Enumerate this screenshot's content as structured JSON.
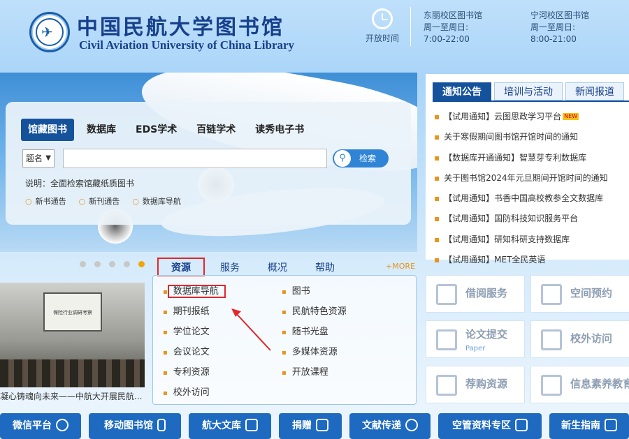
{
  "header": {
    "logo_cn": "中国民航大学图书馆",
    "logo_en": "Civil Aviation University of China Library",
    "open_time_label": "开放时间",
    "campuses": [
      {
        "name": "东丽校区图书馆",
        "days": "周一至周日:",
        "hours": "7:00-22:00"
      },
      {
        "name": "宁河校区图书馆",
        "days": "周一至周日:",
        "hours": "8:00-21:00"
      }
    ]
  },
  "search": {
    "tabs": [
      "馆藏图书",
      "数据库",
      "EDS学术",
      "百链学术",
      "读秀电子书"
    ],
    "field_select": "题名",
    "input_value": "",
    "button": "检索",
    "note": "说明：全面检索馆藏纸质图书",
    "links": [
      "新书通告",
      "新刊通告",
      "数据库导航"
    ]
  },
  "carousel": {
    "dots": 5,
    "active": 5
  },
  "notice": {
    "tabs": [
      "通知公告",
      "培训与活动",
      "新闻报道"
    ],
    "items": [
      "【试用通知】云图思政学习平台",
      "关于寒假期间图书馆开馆时间的通知",
      "【数据库开通通知】智慧芽专利数据库",
      "关于图书馆2024年元旦期间开馆时间的通知",
      "【试用通知】书香中国高校教参全文数据库",
      "【试用通知】国防科技知识服务平台",
      "【试用通知】研知科研支持数据库",
      "【试用通知】MET全民英语"
    ],
    "new_badge": "NEW"
  },
  "photo": {
    "screen_text": "保险行业调研考察",
    "caption": "凝心铸魂向未来——中航大开展民航..."
  },
  "resources": {
    "tabs": [
      "资源",
      "服务",
      "概况",
      "帮助"
    ],
    "more": "+MORE",
    "left": [
      "数据库导航",
      "期刊报纸",
      "学位论文",
      "会议论文",
      "专利资源",
      "校外访问"
    ],
    "right": [
      "图书",
      "民航特色资源",
      "随书光盘",
      "多媒体资源",
      "开放课程"
    ]
  },
  "services": [
    {
      "label": "借阅服务",
      "sub": ""
    },
    {
      "label": "空间预约",
      "sub": ""
    },
    {
      "label": "论文提交",
      "sub": "Paper"
    },
    {
      "label": "校外访问",
      "sub": ""
    },
    {
      "label": "荐购资源",
      "sub": ""
    },
    {
      "label": "信息素养教育",
      "sub": ""
    }
  ],
  "bottom": [
    "微信平台",
    "移动图书馆",
    "航大文库",
    "捐赠",
    "文献传递",
    "空管资料专区",
    "新生指南"
  ]
}
